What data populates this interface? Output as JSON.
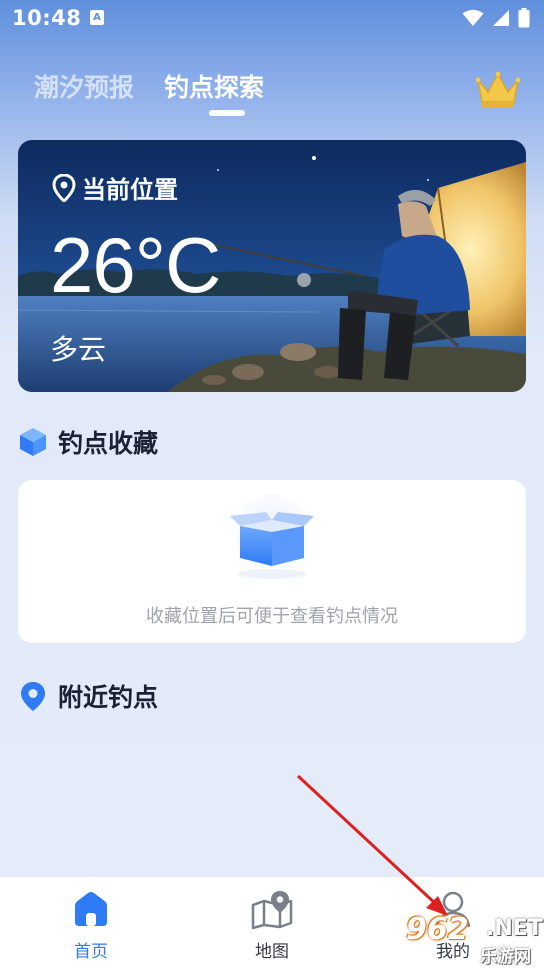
{
  "status_bar": {
    "time": "10:48",
    "notification_letter": "A"
  },
  "tabs": [
    {
      "label": "潮汐预报",
      "active": false
    },
    {
      "label": "钓点探索",
      "active": true
    }
  ],
  "weather": {
    "location_label": "当前位置",
    "temperature": "26°C",
    "condition": "多云"
  },
  "favorites": {
    "title": "钓点收藏",
    "empty_text": "收藏位置后可便于查看钓点情况"
  },
  "nearby": {
    "title": "附近钓点"
  },
  "bottom_nav": [
    {
      "label": "首页",
      "icon": "home-icon",
      "active": true
    },
    {
      "label": "地图",
      "icon": "map-icon",
      "active": false
    },
    {
      "label": "我的",
      "icon": "profile-icon",
      "active": false
    }
  ],
  "watermark": {
    "logo": "962",
    "suffix": ".NET",
    "sub": "乐游网"
  },
  "colors": {
    "accent": "#2f7bf5",
    "header_blue": "#5f8fdc",
    "arrow": "#e02020"
  }
}
